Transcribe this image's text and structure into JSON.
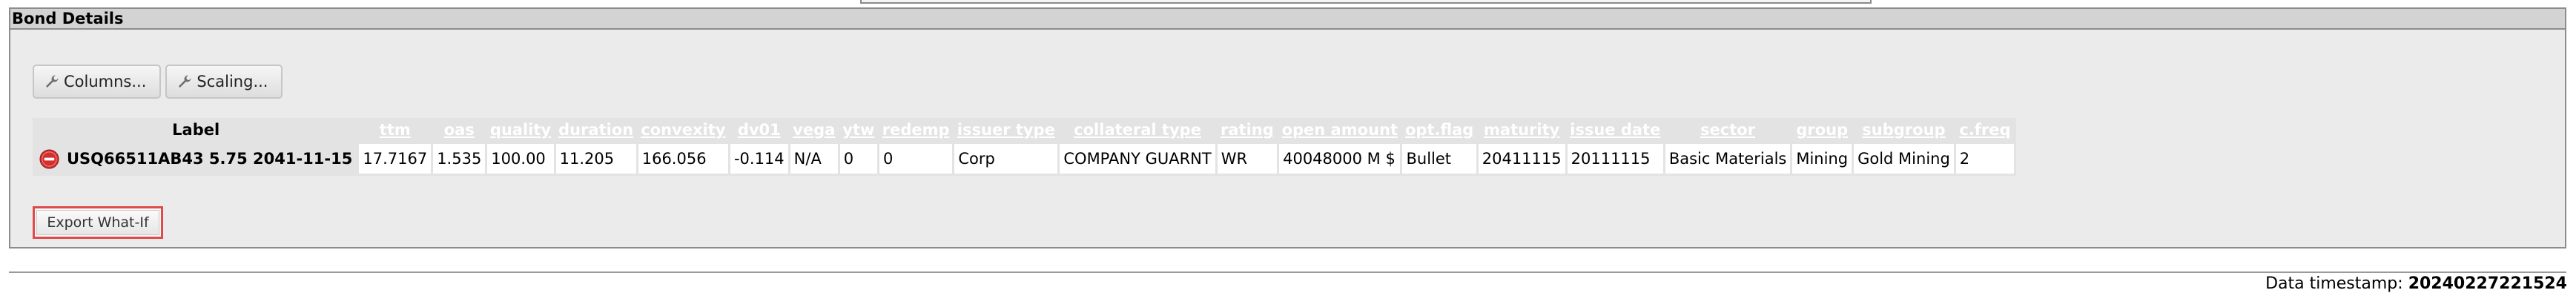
{
  "panel": {
    "title": "Bond Details"
  },
  "toolbar": {
    "columns_label": "Columns...",
    "scaling_label": "Scaling..."
  },
  "table": {
    "label_header": "Label",
    "columns": [
      "ttm",
      "oas",
      "quality",
      "duration",
      "convexity",
      "dv01",
      "vega",
      "ytw",
      "redemp",
      "issuer type",
      "collateral type",
      "rating",
      "open amount",
      "opt.flag",
      "maturity",
      "issue date",
      "sector",
      "group",
      "subgroup",
      "c.freq"
    ],
    "row": {
      "label": "USQ66511AB43 5.75 2041-11-15",
      "cells": [
        "17.7167",
        "1.535",
        "100.00",
        "11.205",
        "166.056",
        "-0.114",
        "N/A",
        "0",
        "0",
        "Corp",
        "COMPANY GUARNT",
        "WR",
        "40048000 M $",
        "Bullet",
        "20411115",
        "20111115",
        "Basic Materials",
        "Mining",
        "Gold Mining",
        "2"
      ]
    }
  },
  "export_label": "Export What-If",
  "footer": {
    "timestamp_label": "Data timestamp:",
    "timestamp_value": "20240227221524"
  },
  "colors": {
    "remove_icon": "#d32f2f",
    "export_border": "#e04a4a",
    "panel_bg": "#ebebeb"
  },
  "icons": {
    "toolbar": "wrench-icon",
    "row_action": "remove-icon"
  }
}
